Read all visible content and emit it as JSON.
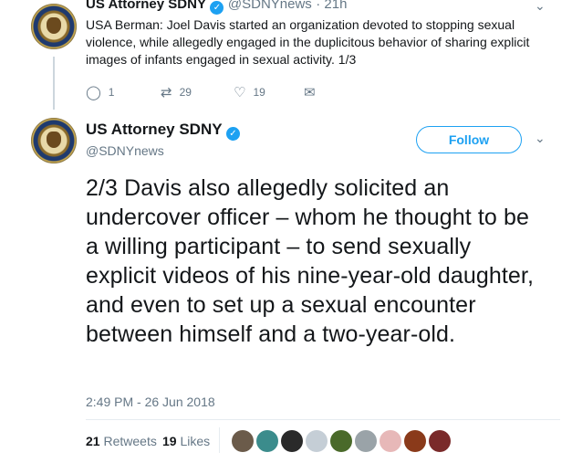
{
  "prev_tweet": {
    "name": "US Attorney SDNY",
    "handle": "@SDNYnews",
    "time": "· 21h",
    "text": "USA Berman: Joel Davis started an organization devoted to stopping sexual violence, while allegedly engaged in the duplicitous behavior of sharing explicit images of infants engaged in sexual activity.  1/3",
    "actions": {
      "replies": "1",
      "retweets": "29",
      "likes": "19"
    }
  },
  "main_tweet": {
    "name": "US Attorney SDNY",
    "handle": "@SDNYnews",
    "follow_label": "Follow",
    "text": "2/3 Davis also allegedly solicited an undercover officer – whom he thought to be a willing participant – to send sexually explicit videos of his nine-year-old daughter, and even to set up a sexual encounter between himself and a two-year-old.",
    "timestamp": "2:49 PM - 26 Jun 2018",
    "retweets_count": "21",
    "retweets_label": "Retweets",
    "likes_count": "19",
    "likes_label": "Likes"
  },
  "liker_avatars": [
    {
      "color": "#6b5b4a"
    },
    {
      "color": "#3b8c8c"
    },
    {
      "color": "#2a2a2a"
    },
    {
      "color": "#c5ced6"
    },
    {
      "color": "#4a6a2a"
    },
    {
      "color": "#9aa3a8"
    },
    {
      "color": "#e7b8b8"
    },
    {
      "color": "#8a3a1a"
    },
    {
      "color": "#7a2a2a"
    }
  ]
}
